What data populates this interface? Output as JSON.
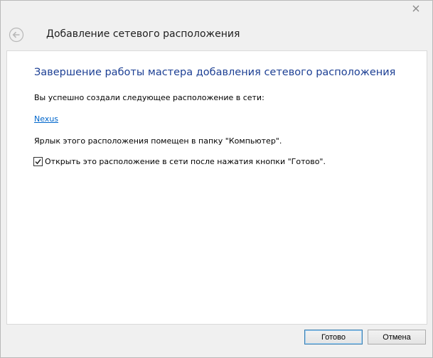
{
  "window": {
    "header_title": "Добавление сетевого расположения"
  },
  "content": {
    "heading": "Завершение работы мастера добавления сетевого расположения",
    "success_text": "Вы успешно создали следующее расположение в сети:",
    "location_link": "Nexus",
    "shortcut_text": "Ярлык этого расположения помещен в папку \"Компьютер\".",
    "checkbox": {
      "label": "Открыть это расположение в сети после нажатия кнопки \"Готово\".",
      "checked": true
    }
  },
  "footer": {
    "finish_label": "Готово",
    "cancel_label": "Отмена"
  },
  "icons": {
    "close": "close-icon",
    "back": "back-arrow-icon",
    "check": "checkmark-icon"
  }
}
